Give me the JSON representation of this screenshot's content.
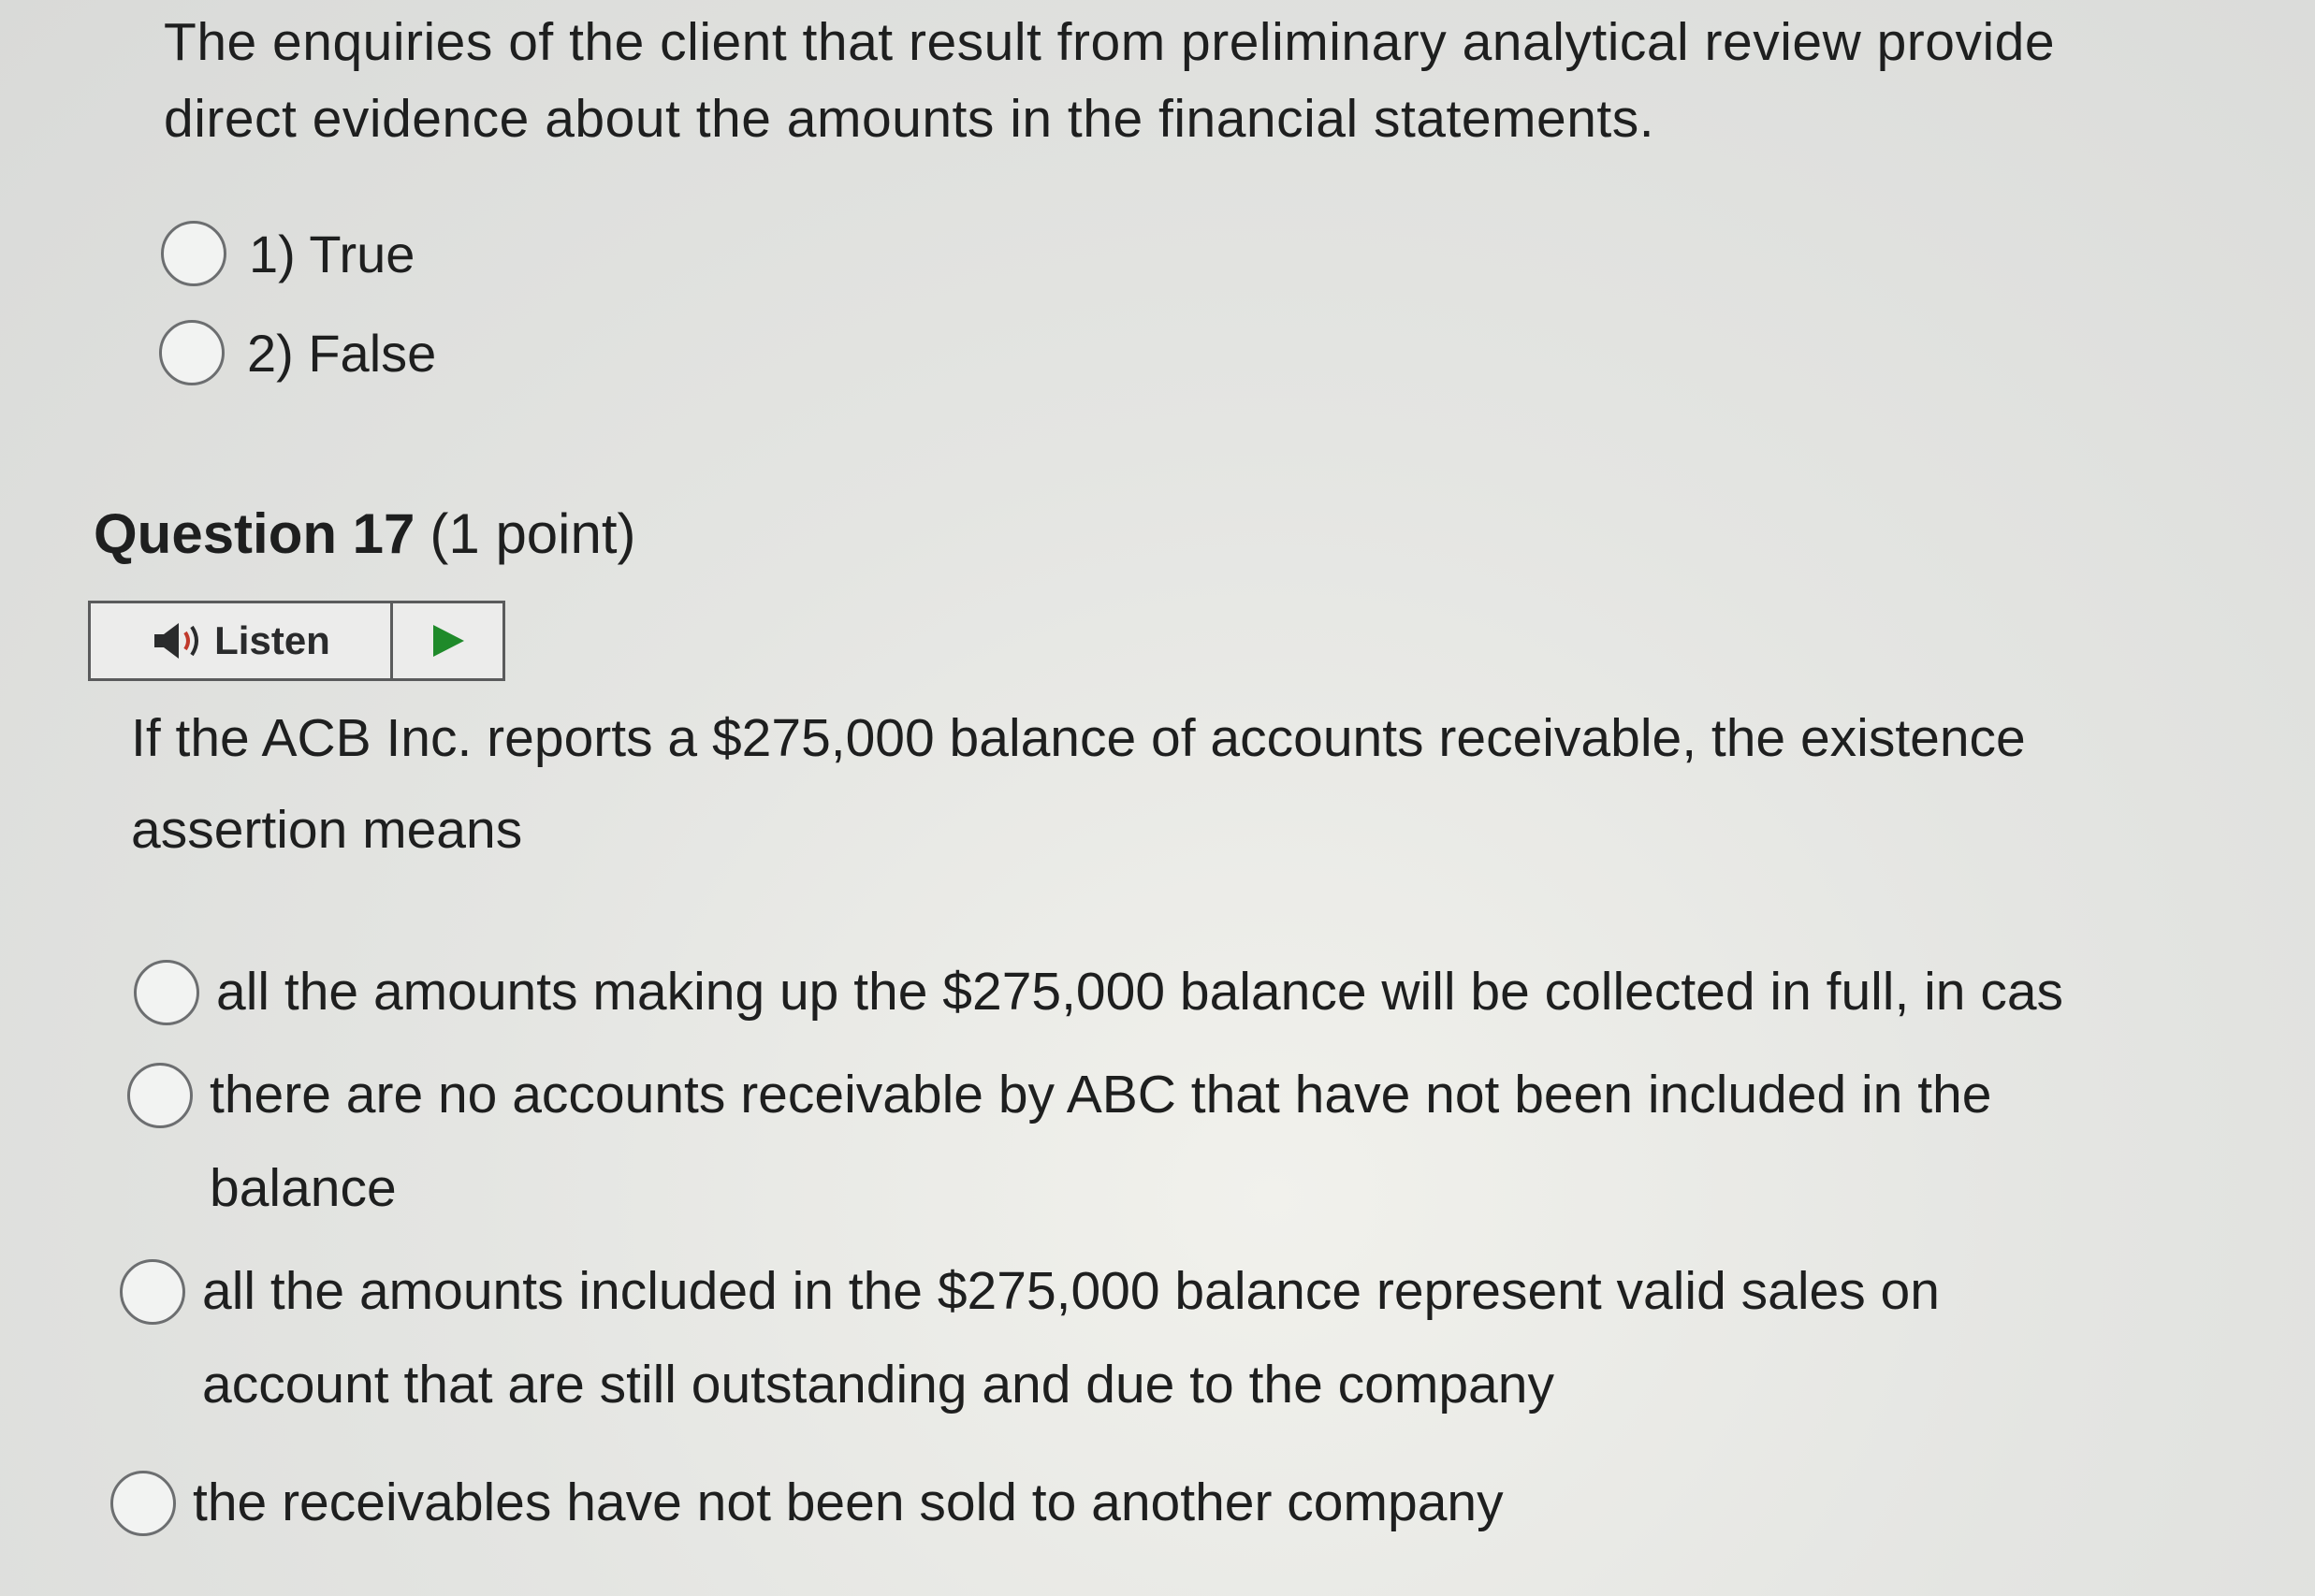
{
  "previous_question": {
    "text_line1": "The enquiries of the client that result from preliminary analytical review provide",
    "text_line2": "direct evidence about the amounts in the financial statements.",
    "options": [
      {
        "label": "1) True"
      },
      {
        "label": "2) False"
      }
    ]
  },
  "question": {
    "title": "Question 17",
    "points": "(1 point)",
    "listen_label": "Listen",
    "text_line1": "If the ACB Inc. reports a $275,000 balance of accounts receivable, the existence",
    "text_line2": "assertion means",
    "options": [
      {
        "line1": "all the amounts making up the $275,000 balance will be collected in full, in cas",
        "line2": ""
      },
      {
        "line1": "there are no accounts receivable by ABC that have not been included in the",
        "line2": "balance"
      },
      {
        "line1": "all the amounts included in the $275,000 balance represent valid sales on",
        "line2": "account that are still outstanding and due to the company"
      },
      {
        "line1": "the receivables have not been sold to another company",
        "line2": ""
      }
    ]
  },
  "icons": {
    "speaker": "speaker-icon",
    "play": "play-icon"
  },
  "colors": {
    "play_green": "#1f8a2a",
    "radio_border": "#6c6e70"
  }
}
